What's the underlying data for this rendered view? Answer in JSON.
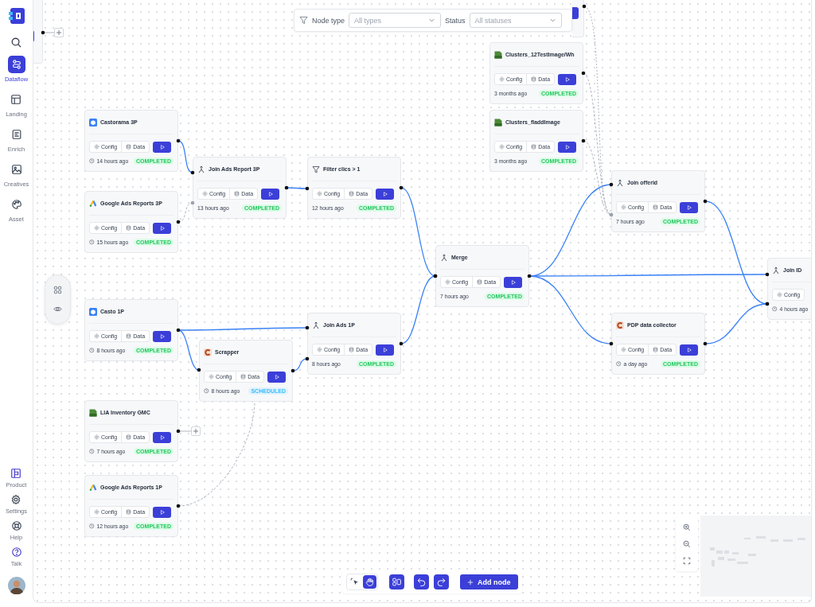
{
  "sidebar": {
    "items": [
      {
        "label": "Dataflow",
        "selected": true
      },
      {
        "label": "Landing",
        "selected": false
      },
      {
        "label": "Enrich",
        "selected": false
      },
      {
        "label": "Creatives",
        "selected": false
      },
      {
        "label": "Asset",
        "selected": false
      }
    ],
    "bottom_items": [
      {
        "label": "Product"
      },
      {
        "label": "Settings"
      },
      {
        "label": "Help"
      },
      {
        "label": "Talk"
      }
    ]
  },
  "filter_bar": {
    "node_type_label": "Node type",
    "node_type_placeholder": "All types",
    "status_label": "Status",
    "status_placeholder": "All statuses"
  },
  "nodes": [
    {
      "title": "Castorama 3P",
      "kind": "cube",
      "buttons": [
        "Config",
        "Data"
      ],
      "clock": true,
      "time": "14 hours ago",
      "status": {
        "label": "COMPLETED",
        "kind": "completed"
      }
    },
    {
      "title": "Google Ads  Reports 3P",
      "kind": "ads",
      "buttons": [
        "Config",
        "Data"
      ],
      "clock": true,
      "time": "15 hours ago",
      "status": {
        "label": "COMPLETED",
        "kind": "completed"
      }
    },
    {
      "title": "Join Ads Report 3P",
      "kind": "join",
      "buttons": [
        "Config",
        "Data"
      ],
      "clock": false,
      "time": "13 hours ago",
      "status": {
        "label": "COMPLETED",
        "kind": "completed"
      }
    },
    {
      "title": "Filter clics > 1",
      "kind": "filter",
      "buttons": [
        "Config",
        "Data"
      ],
      "clock": false,
      "time": "12 hours ago",
      "status": {
        "label": "COMPLETED",
        "kind": "completed"
      }
    },
    {
      "title": "Clusters_12TestImage/Wh",
      "kind": "csv",
      "buttons": [
        "Config",
        "Data"
      ],
      "clock": false,
      "time": "3 months ago",
      "status": {
        "label": "COMPLETED",
        "kind": "completed"
      }
    },
    {
      "title": "Clusters_fladdImage",
      "kind": "csv",
      "buttons": [
        "Config",
        "Data"
      ],
      "clock": false,
      "time": "3 months ago",
      "status": {
        "label": "COMPLETED",
        "kind": "completed"
      }
    },
    {
      "title": "Join offerid",
      "kind": "join",
      "buttons": [
        "Config",
        "Data"
      ],
      "clock": false,
      "time": "7 hours ago",
      "status": {
        "label": "COMPLETED",
        "kind": "completed"
      }
    },
    {
      "title": "Merge",
      "kind": "join",
      "buttons": [
        "Config",
        "Data"
      ],
      "clock": false,
      "time": "7 hours ago",
      "status": {
        "label": "COMPLETED",
        "kind": "completed"
      }
    },
    {
      "title": "Join ID",
      "kind": "join",
      "buttons": [
        "Config"
      ],
      "clock": true,
      "time": "4 hours ago"
    },
    {
      "title": "Casto 1P",
      "kind": "cube",
      "buttons": [
        "Config",
        "Data"
      ],
      "clock": true,
      "time": "8 hours ago",
      "status": {
        "label": "COMPLETED",
        "kind": "completed"
      }
    },
    {
      "title": "Scrapper",
      "kind": "scraper",
      "buttons": [
        "Config",
        "Data"
      ],
      "clock": true,
      "time": "8 hours ago",
      "status": {
        "label": "SCHEDULED",
        "kind": "scheduled"
      }
    },
    {
      "title": "Join Ads 1P",
      "kind": "join",
      "buttons": [
        "Config",
        "Data"
      ],
      "clock": false,
      "time": "8 hours ago",
      "status": {
        "label": "COMPLETED",
        "kind": "completed"
      }
    },
    {
      "title": "PDP data collector",
      "kind": "scraper",
      "buttons": [
        "Config",
        "Data"
      ],
      "clock": true,
      "time": "a day ago",
      "status": {
        "label": "COMPLETED",
        "kind": "completed"
      }
    },
    {
      "title": "LIA Inventory GMC",
      "kind": "csv",
      "buttons": [
        "Config",
        "Data"
      ],
      "clock": true,
      "time": "7 hours ago",
      "status": {
        "label": "COMPLETED",
        "kind": "completed"
      }
    },
    {
      "title": "Google Ads Reports 1P",
      "kind": "ads",
      "buttons": [
        "Config",
        "Data"
      ],
      "clock": true,
      "time": "12 hours ago",
      "status": {
        "label": "COMPLETED",
        "kind": "completed"
      }
    }
  ],
  "toolbar": {
    "tools": [
      {
        "kind": "pointer",
        "selected": false
      },
      {
        "kind": "hand",
        "selected": true
      }
    ],
    "add_node_label": "Add node"
  }
}
